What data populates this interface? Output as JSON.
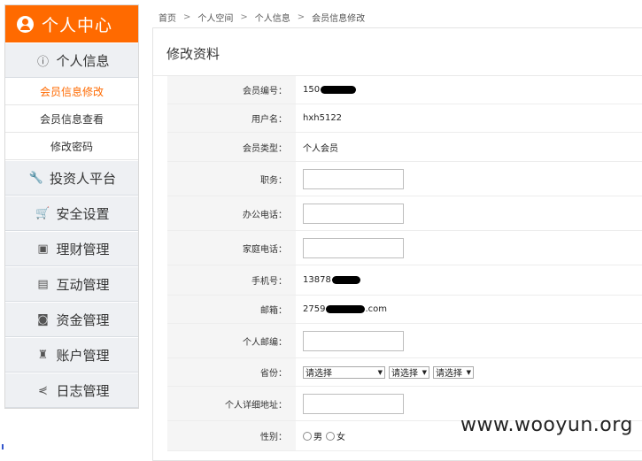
{
  "sidebar": {
    "title": "个人中心",
    "groups": [
      {
        "label": "个人信息",
        "icon": "info-icon"
      },
      {
        "label": "投资人平台",
        "icon": "wrench-icon"
      },
      {
        "label": "安全设置",
        "icon": "cart-icon"
      },
      {
        "label": "理财管理",
        "icon": "finance-icon"
      },
      {
        "label": "互动管理",
        "icon": "interaction-icon"
      },
      {
        "label": "资金管理",
        "icon": "camera-icon"
      },
      {
        "label": "账户管理",
        "icon": "account-icon"
      },
      {
        "label": "日志管理",
        "icon": "share-icon"
      }
    ],
    "subitems": [
      {
        "label": "会员信息修改",
        "active": true
      },
      {
        "label": "会员信息查看",
        "active": false
      },
      {
        "label": "修改密码",
        "active": false
      }
    ]
  },
  "breadcrumb": [
    "首页",
    "个人空间",
    "个人信息",
    "会员信息修改"
  ],
  "panel": {
    "title": "修改资料"
  },
  "form": {
    "member_id": {
      "label": "会员编号：",
      "value": "150"
    },
    "username": {
      "label": "用户名：",
      "value": "hxh5122"
    },
    "member_type": {
      "label": "会员类型：",
      "value": "个人会员"
    },
    "position": {
      "label": "职务："
    },
    "office_phone": {
      "label": "办公电话："
    },
    "home_phone": {
      "label": "家庭电话："
    },
    "mobile": {
      "label": "手机号：",
      "value": "13878"
    },
    "email": {
      "label": "邮箱：",
      "value_prefix": "2759",
      "value_suffix": ".com"
    },
    "postcode": {
      "label": "个人邮编："
    },
    "province": {
      "label": "省份：",
      "selects": [
        "请选择",
        "请选择",
        "请选择"
      ]
    },
    "address": {
      "label": "个人详细地址："
    },
    "gender": {
      "label": "性别：",
      "options": [
        "男",
        "女"
      ]
    }
  },
  "watermark": "www.wooyun.org",
  "colors": {
    "accent": "#ff6a00",
    "sidebar_group_bg": "#eef0f3",
    "label_bg": "#f5f5f5"
  }
}
